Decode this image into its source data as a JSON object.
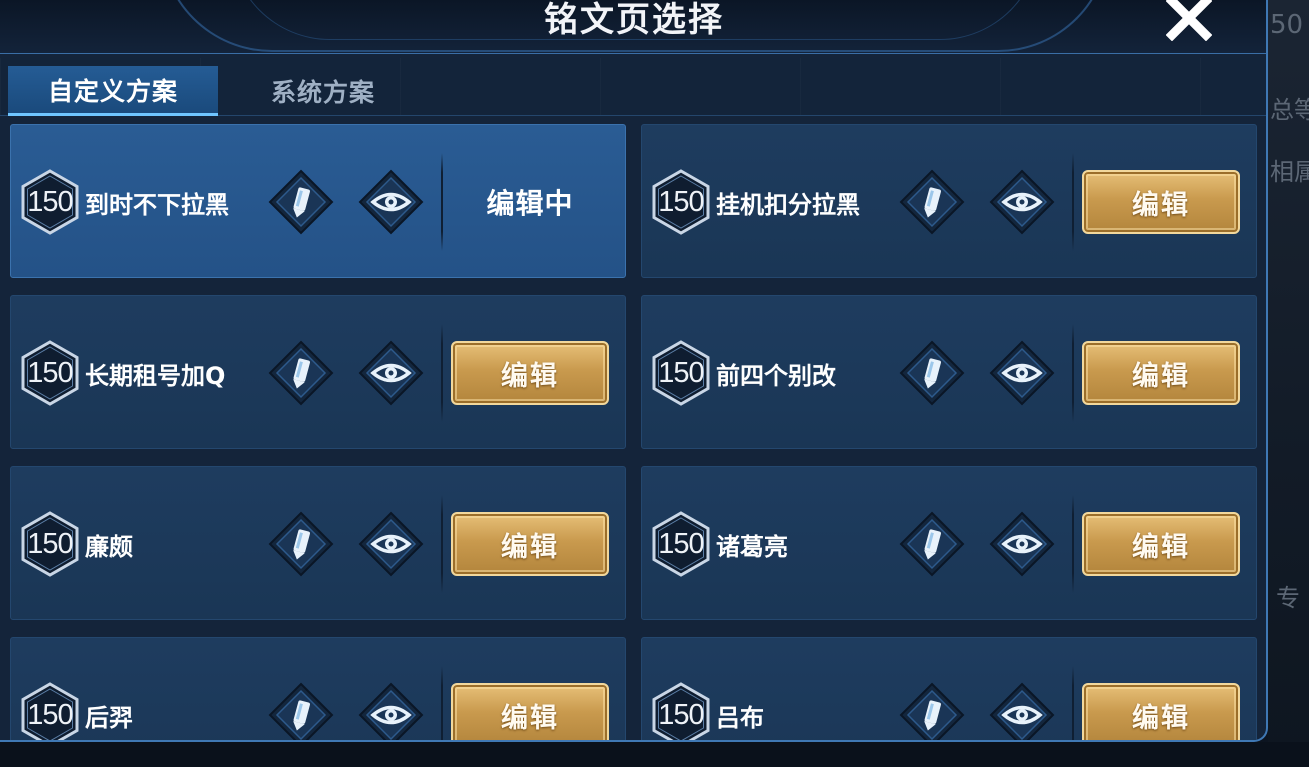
{
  "dialog": {
    "title": "铭文页选择",
    "close_icon": "close-icon"
  },
  "tabs": [
    {
      "label": "自定义方案",
      "active": true
    },
    {
      "label": "系统方案",
      "active": false
    }
  ],
  "plans": [
    {
      "level": "150",
      "name": "到时不下拉黑",
      "action": "编辑中",
      "editing": true
    },
    {
      "level": "150",
      "name": "挂机扣分拉黑",
      "action": "编辑",
      "editing": false
    },
    {
      "level": "150",
      "name": "长期租号加Q",
      "action": "编辑",
      "editing": false
    },
    {
      "level": "150",
      "name": "前四个别改",
      "action": "编辑",
      "editing": false
    },
    {
      "level": "150",
      "name": "廉颇",
      "action": "编辑",
      "editing": false
    },
    {
      "level": "150",
      "name": "诸葛亮",
      "action": "编辑",
      "editing": false
    },
    {
      "level": "150",
      "name": "后羿",
      "action": "编辑",
      "editing": false
    },
    {
      "level": "150",
      "name": "吕布",
      "action": "编辑",
      "editing": false
    }
  ],
  "background_fragments": {
    "level": "50",
    "total": "总等",
    "attr": "相属",
    "special": "专"
  },
  "icons": {
    "rename": "pencil-icon",
    "preview": "eye-icon",
    "level": "hexagon-level-badge"
  },
  "colors": {
    "card": "#1e3c5f",
    "card_active": "#2a5c94",
    "gold_button": "#c99a4e",
    "tab_accent": "#6fc5ff"
  }
}
